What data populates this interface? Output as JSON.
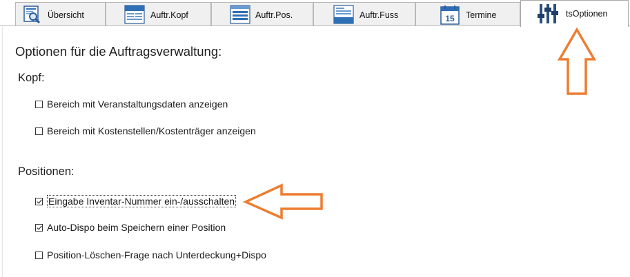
{
  "tabs": [
    {
      "label": "Übersicht",
      "icon": "overview-document-magnifier-icon"
    },
    {
      "label": "Auftr.Kopf",
      "icon": "order-header-form-icon"
    },
    {
      "label": "Auftr.Pos.",
      "icon": "order-positions-form-icon"
    },
    {
      "label": "Auftr.Fuss",
      "icon": "order-footer-form-icon"
    },
    {
      "label": "Termine",
      "icon": "calendar-icon",
      "icon_text": "15"
    },
    {
      "label": "tsOptionen",
      "icon": "sliders-icon",
      "active": true
    }
  ],
  "main": {
    "heading": "Optionen für die Auftragsverwaltung:",
    "sections": [
      {
        "title": "Kopf:",
        "options": [
          {
            "label": "Bereich mit Veranstaltungsdaten anzeigen",
            "checked": false
          },
          {
            "label": "Bereich mit Kostenstellen/Kostenträger anzeigen",
            "checked": false
          }
        ]
      },
      {
        "title": "Positionen:",
        "options": [
          {
            "label": "Eingabe Inventar-Nummer ein-/ausschalten",
            "checked": true,
            "focused": true
          },
          {
            "label": "Auto-Dispo beim Speichern einer Position",
            "checked": true
          },
          {
            "label": "Position-Löschen-Frage nach Unterdeckung+Dispo",
            "checked": false
          }
        ]
      }
    ]
  },
  "annotations": {
    "arrow_color": "#ed7d31",
    "arrows": [
      "up-arrow pointing at tsOptionen tab",
      "left-arrow pointing at Eingabe Inventar-Nummer option"
    ]
  },
  "colors": {
    "tab_bg": "#f0f0f0",
    "tab_border": "#b9b9b9",
    "icon_blue": "#2f6fb5"
  }
}
